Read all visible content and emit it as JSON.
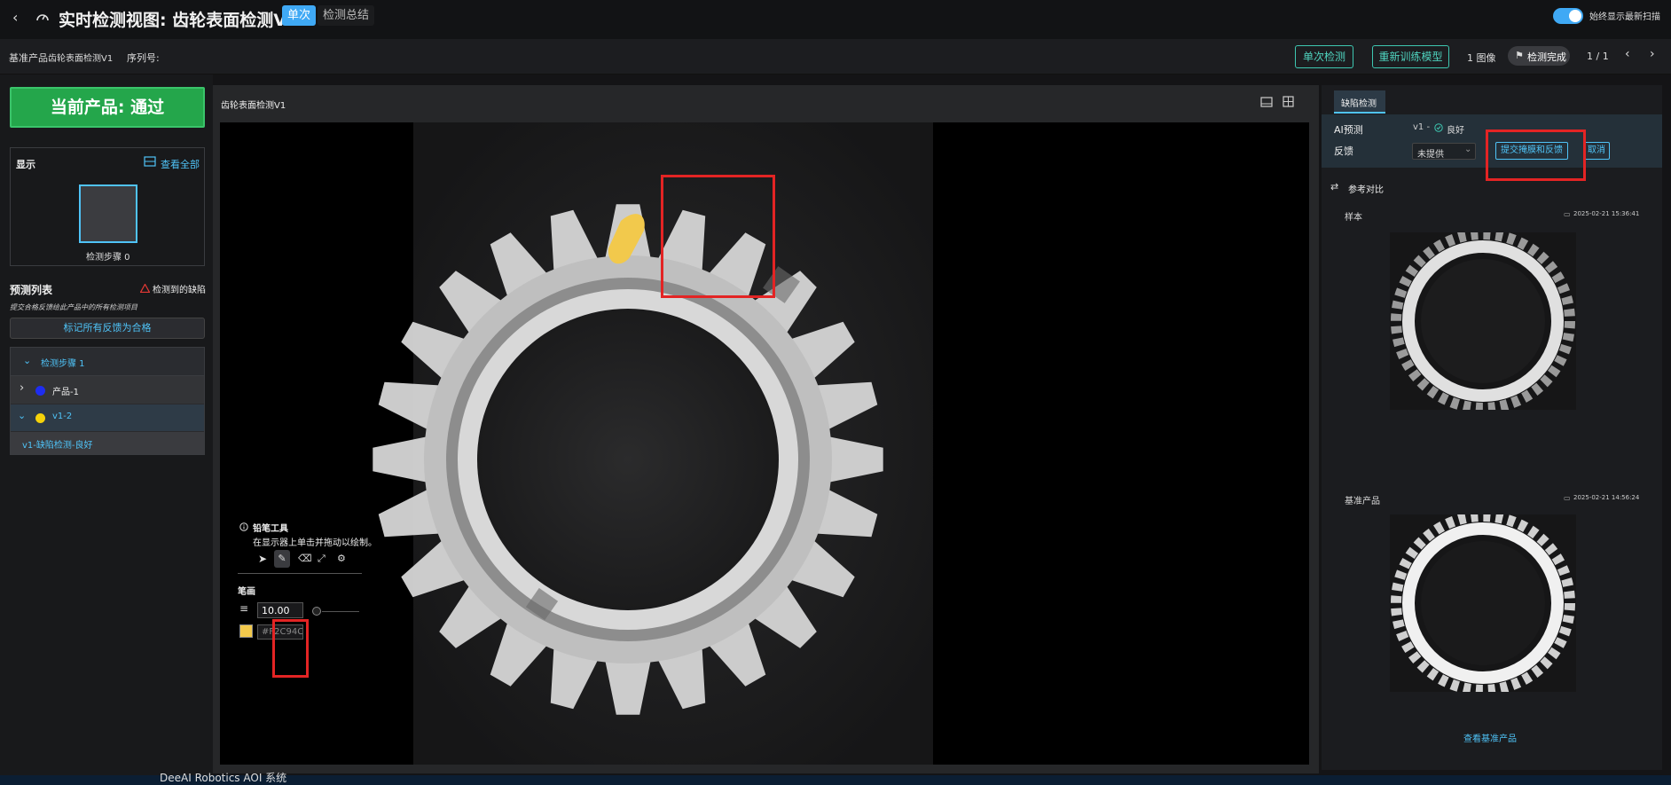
{
  "header": {
    "title": "实时检测视图: 齿轮表面检测V1",
    "modes": [
      "单次",
      "检测总结"
    ],
    "toggle_label": "始终显示最新扫描"
  },
  "subheader": {
    "base_product_label": "基准产品",
    "base_product_value": "齿轮表面检测V1",
    "serial_label": "序列号:",
    "single_detect_button": "单次检测",
    "retrain_button": "重新训练模型",
    "image_count": "1 图像",
    "status_badge": "检测完成",
    "page_indicator": "1 / 1"
  },
  "left": {
    "result_button": "当前产品: 通过",
    "display_title": "显示",
    "view_all": "查看全部",
    "thumbnail_label": "检测步骤 0",
    "prediction_title": "预测列表",
    "defect_badge": "检测到的缺陷",
    "hint": "提交合格反馈给此产品中的所有检测项目",
    "mark_all_button": "标记所有反馈为合格",
    "tree": {
      "step": "检测步骤 1",
      "product": "产品-1",
      "version": "v1-2",
      "result": "v1-缺陷检测-良好"
    }
  },
  "center": {
    "title": "齿轮表面检测V1",
    "tool": {
      "title": "铅笔工具",
      "hint": "在显示器上单击并拖动以绘制。",
      "stroke_label": "笔画",
      "stroke_value": "10.00",
      "color_value": "#F2C94C"
    }
  },
  "right": {
    "tab": "缺陷检测",
    "ai_label": "AI预测",
    "ai_version": "v1 -",
    "ai_result": "良好",
    "feedback_label": "反馈",
    "feedback_select": "未提供",
    "submit_button": "提交掩膜和反馈",
    "cancel_button": "取消",
    "compare_title": "参考对比",
    "sample_label": "样本",
    "sample_time": "2025-02-21 15:36:41",
    "base_label": "基准产品",
    "base_time": "2025-02-21 14:56:24",
    "view_base_link": "查看基准产品"
  },
  "taskbar": {
    "app_name": "DeeAI Robotics AOI 系统"
  },
  "colors": {
    "accent": "#4fc3f7",
    "pass_green": "#24a64b",
    "teal": "#3ec7b1",
    "highlight_red": "#e32424",
    "brush_yellow": "#F2C94C"
  }
}
